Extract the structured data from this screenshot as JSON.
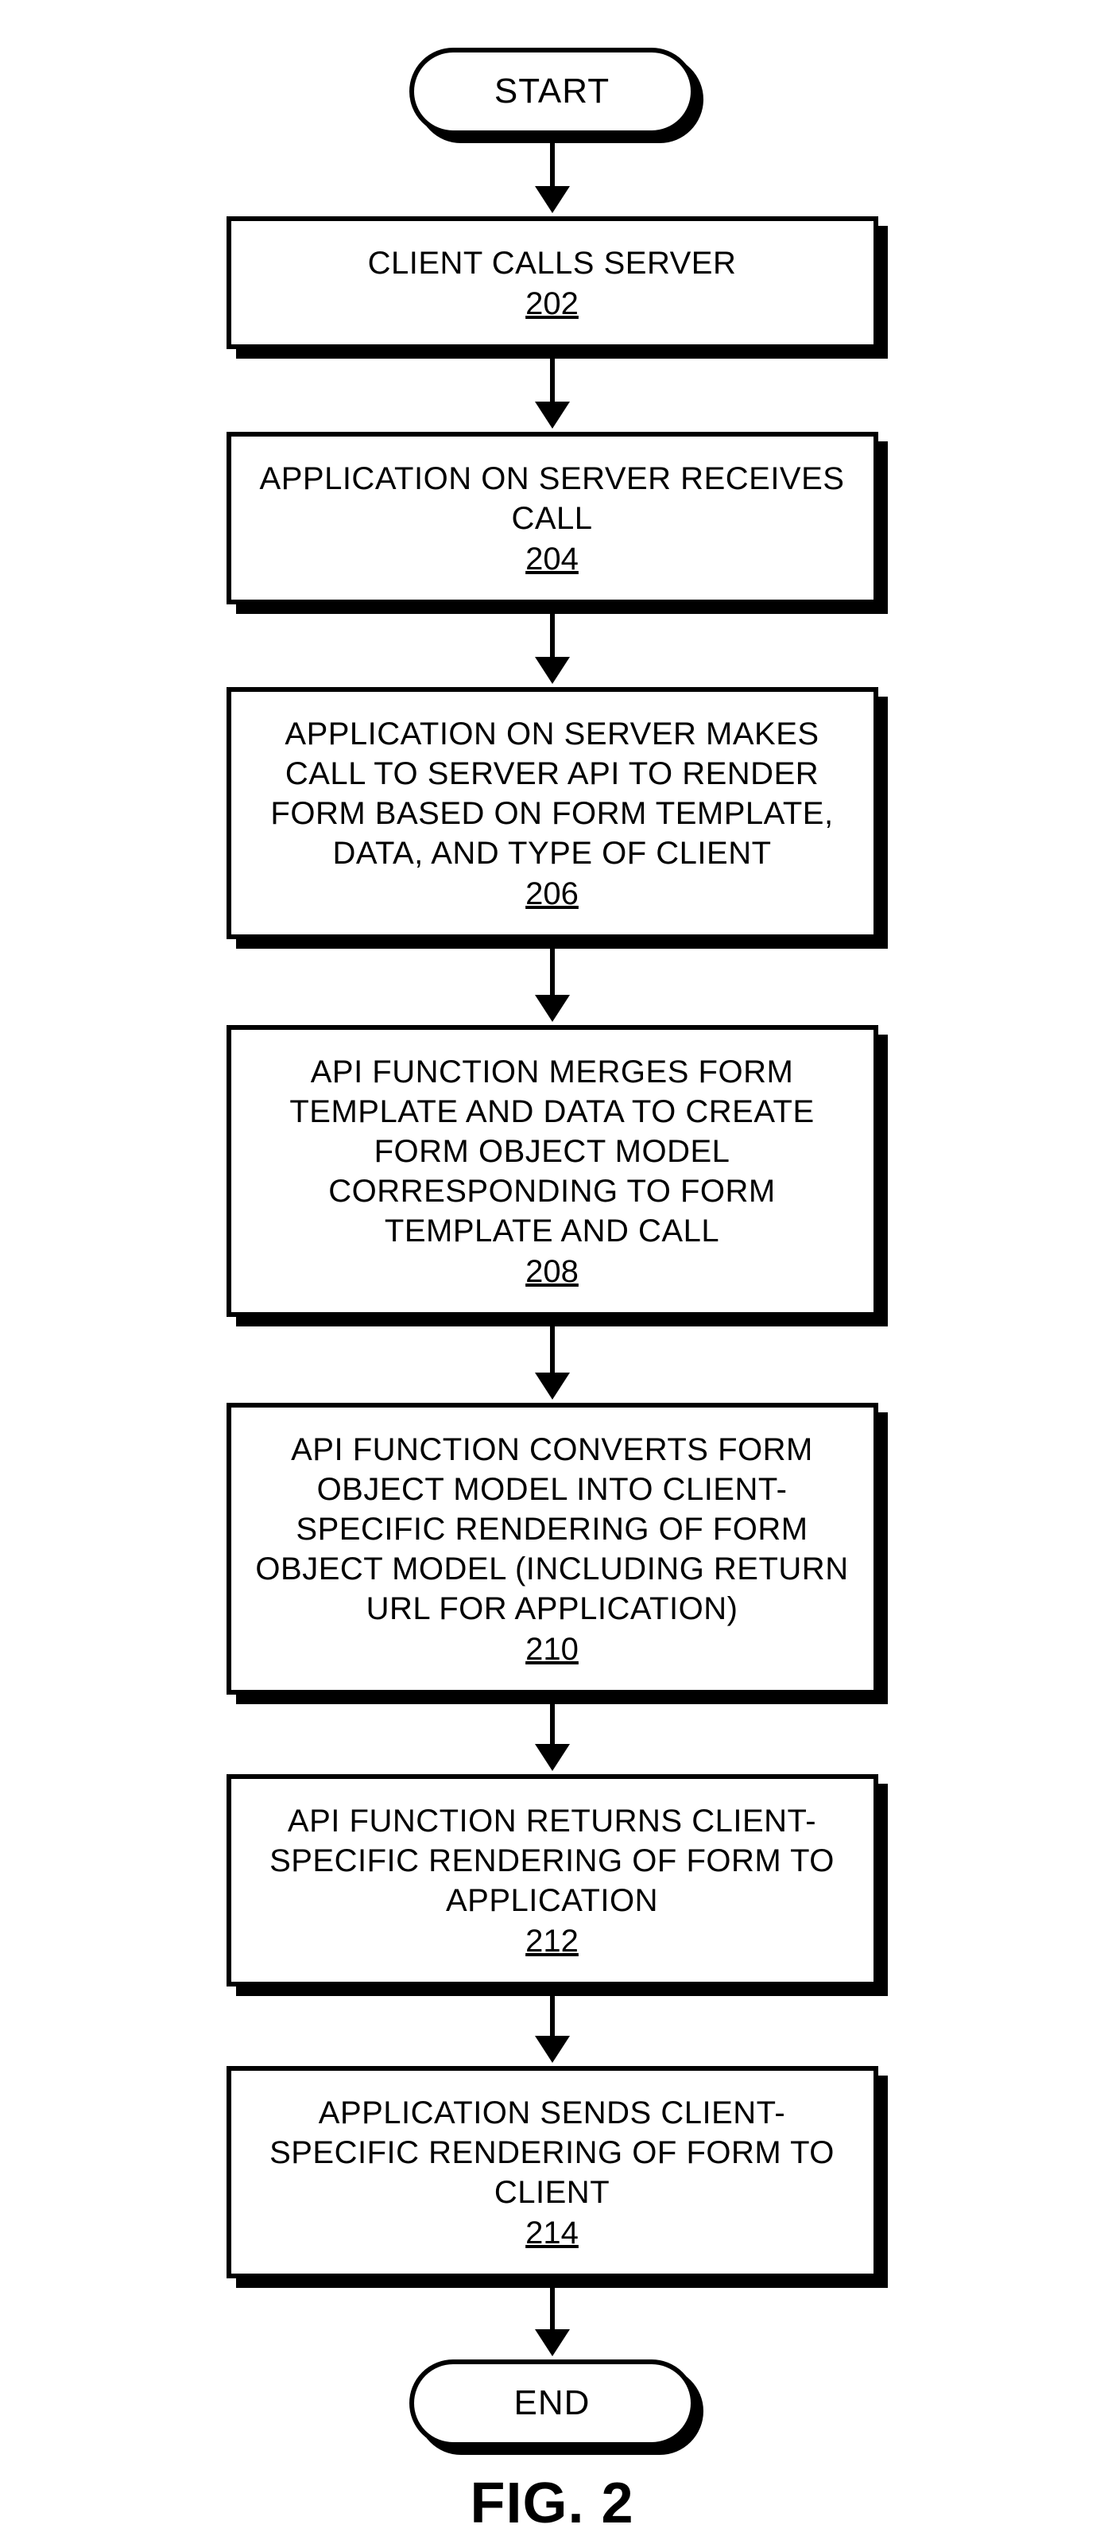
{
  "chart_data": {
    "type": "flowchart",
    "title": "FIG. 2",
    "nodes": [
      {
        "id": "start",
        "type": "terminator",
        "label": "START"
      },
      {
        "id": "202",
        "type": "process",
        "text": "CLIENT CALLS SERVER",
        "ref": "202"
      },
      {
        "id": "204",
        "type": "process",
        "text": "APPLICATION ON SERVER RECEIVES CALL",
        "ref": "204"
      },
      {
        "id": "206",
        "type": "process",
        "text": "APPLICATION ON SERVER MAKES CALL TO SERVER API TO RENDER FORM BASED ON FORM TEMPLATE, DATA, AND TYPE OF CLIENT",
        "ref": "206"
      },
      {
        "id": "208",
        "type": "process",
        "text": "API FUNCTION MERGES FORM TEMPLATE AND DATA TO CREATE FORM OBJECT MODEL CORRESPONDING TO FORM TEMPLATE AND CALL",
        "ref": "208"
      },
      {
        "id": "210",
        "type": "process",
        "text": "API FUNCTION CONVERTS FORM OBJECT MODEL INTO CLIENT-SPECIFIC RENDERING OF FORM OBJECT MODEL (INCLUDING RETURN URL FOR APPLICATION)",
        "ref": "210"
      },
      {
        "id": "212",
        "type": "process",
        "text": "API FUNCTION RETURNS CLIENT-SPECIFIC RENDERING OF FORM TO APPLICATION",
        "ref": "212"
      },
      {
        "id": "214",
        "type": "process",
        "text": "APPLICATION SENDS CLIENT-SPECIFIC RENDERING OF FORM TO CLIENT",
        "ref": "214"
      },
      {
        "id": "end",
        "type": "terminator",
        "label": "END"
      }
    ],
    "edges": [
      [
        "start",
        "202"
      ],
      [
        "202",
        "204"
      ],
      [
        "204",
        "206"
      ],
      [
        "206",
        "208"
      ],
      [
        "208",
        "210"
      ],
      [
        "210",
        "212"
      ],
      [
        "212",
        "214"
      ],
      [
        "214",
        "end"
      ]
    ]
  },
  "terminators": {
    "start": "START",
    "end": "END"
  },
  "steps": {
    "s202": {
      "text": "CLIENT CALLS SERVER",
      "ref": "202"
    },
    "s204": {
      "text": "APPLICATION ON SERVER RECEIVES CALL",
      "ref": "204"
    },
    "s206": {
      "text": "APPLICATION ON SERVER MAKES CALL TO SERVER API TO RENDER FORM BASED ON FORM TEMPLATE, DATA, AND TYPE OF CLIENT",
      "ref": "206"
    },
    "s208": {
      "text": "API FUNCTION MERGES FORM TEMPLATE AND DATA TO CREATE FORM OBJECT MODEL CORRESPONDING TO FORM TEMPLATE AND CALL",
      "ref": "208"
    },
    "s210": {
      "text": "API FUNCTION CONVERTS FORM OBJECT MODEL INTO CLIENT-SPECIFIC RENDERING OF FORM OBJECT MODEL (INCLUDING RETURN URL FOR APPLICATION)",
      "ref": "210"
    },
    "s212": {
      "text": "API FUNCTION RETURNS CLIENT-SPECIFIC RENDERING OF FORM TO APPLICATION",
      "ref": "212"
    },
    "s214": {
      "text": "APPLICATION SENDS CLIENT-SPECIFIC RENDERING OF FORM TO CLIENT",
      "ref": "214"
    }
  },
  "caption": "FIG. 2"
}
